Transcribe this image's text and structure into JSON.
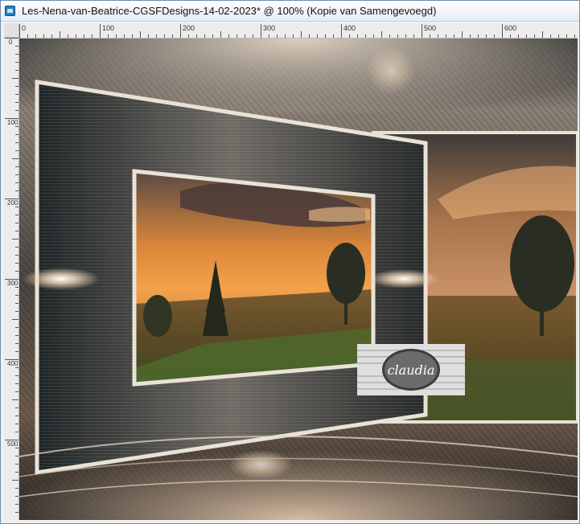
{
  "window": {
    "title": "Les-Nena-van-Beatrice-CGSFDesigns-14-02-2023* @ 100% (Kopie van Samengevoegd)"
  },
  "ruler_top": {
    "labels": [
      "0",
      "100",
      "200",
      "300",
      "400",
      "500",
      "600"
    ]
  },
  "ruler_left": {
    "labels": [
      "0",
      "100",
      "200",
      "300",
      "400",
      "500"
    ]
  },
  "watermark": {
    "text": "claudia"
  },
  "colors": {
    "titlebar_top": "#ffffff",
    "titlebar_bottom": "#e6ecf3",
    "ruler": "#ececec",
    "sky_warm": "#f4a24a",
    "frame_border": "#e9e2d6"
  },
  "icons": {
    "app": "psp-document-icon"
  }
}
